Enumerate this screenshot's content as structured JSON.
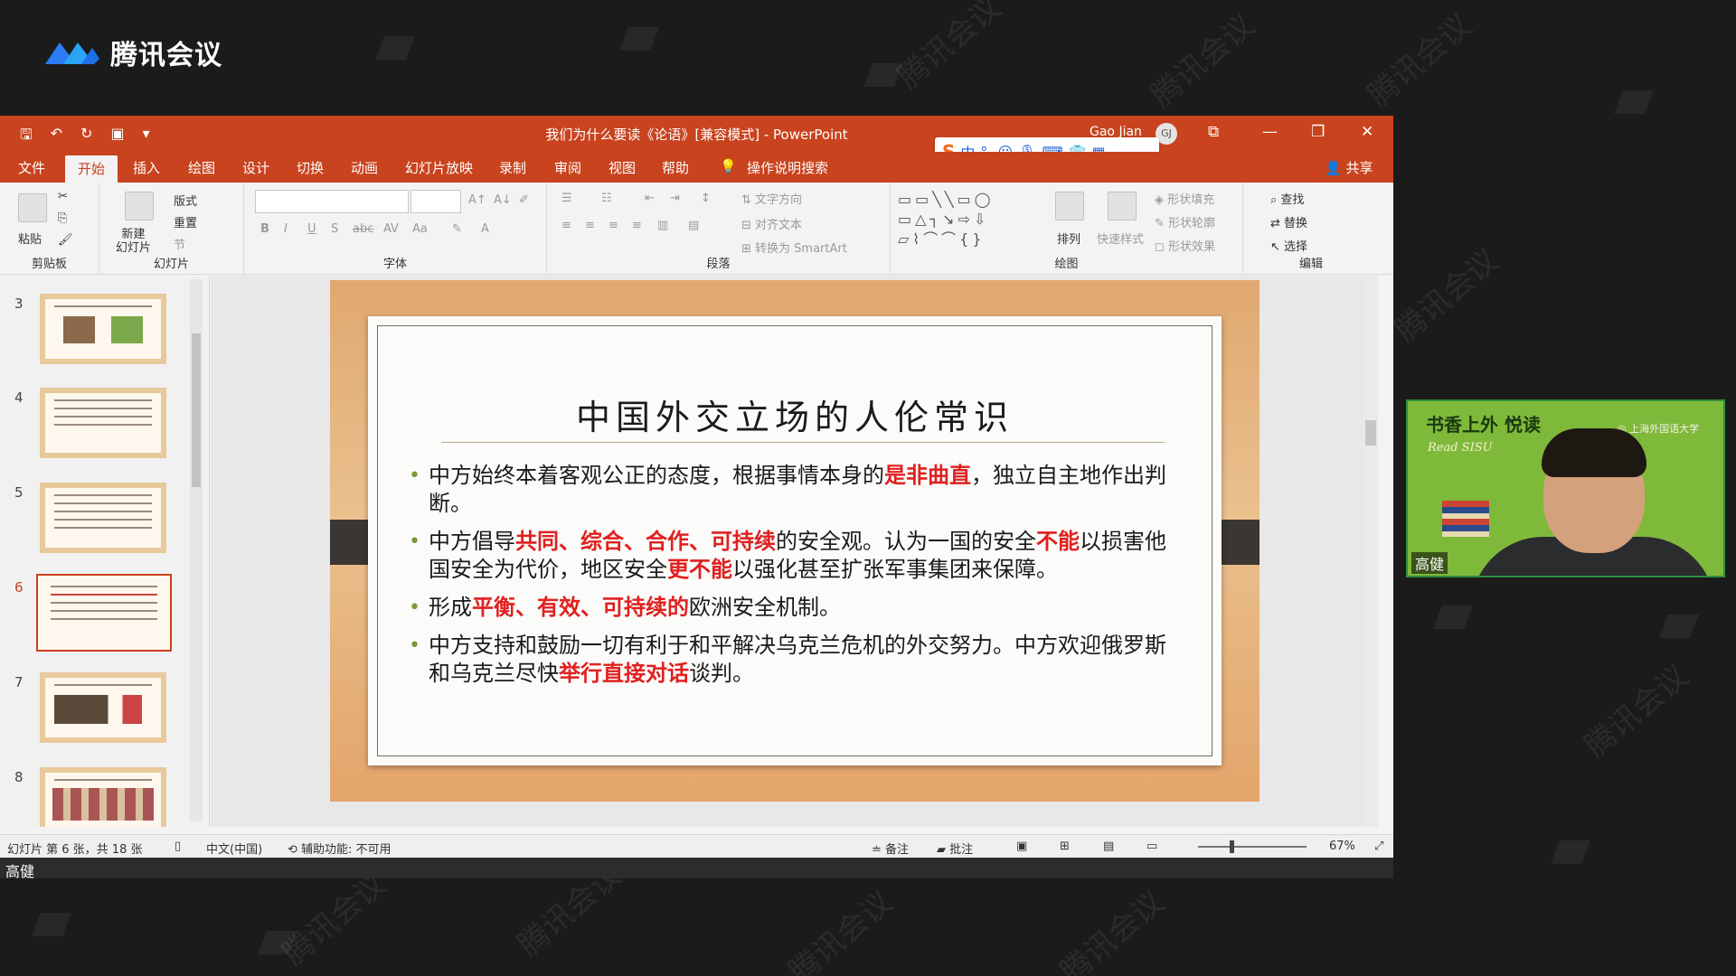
{
  "app": {
    "name": "腾讯会议",
    "watermark": "腾讯会议"
  },
  "ppt": {
    "titlebar": {
      "title": "我们为什么要读《论语》[兼容模式] - PowerPoint",
      "user": "Gao Jian",
      "avatar_initials": "GJ"
    },
    "ime": {
      "mode": "中"
    },
    "menu": {
      "tabs": [
        "文件",
        "开始",
        "插入",
        "绘图",
        "设计",
        "切换",
        "动画",
        "幻灯片放映",
        "录制",
        "审阅",
        "视图",
        "帮助",
        "操作说明搜索"
      ],
      "active_tab": "开始",
      "share": "共享"
    },
    "ribbon": {
      "clipboard": {
        "label": "剪贴板",
        "paste": "粘贴"
      },
      "slides": {
        "label": "幻灯片",
        "new_slide": "新建\n幻灯片",
        "layout": "版式",
        "reset": "重置",
        "section": "节"
      },
      "font": {
        "label": "字体"
      },
      "paragraph": {
        "label": "段落",
        "text_direction": "文字方向",
        "align_text": "对齐文本",
        "convert_smartart": "转换为 SmartArt"
      },
      "drawing": {
        "label": "绘图",
        "arrange": "排列",
        "quick_styles": "快速样式",
        "shape_fill": "形状填充",
        "shape_outline": "形状轮廓",
        "shape_effects": "形状效果"
      },
      "editing": {
        "label": "编辑",
        "find": "查找",
        "replace": "替换",
        "select": "选择"
      }
    },
    "thumbnails": [
      {
        "num": "3"
      },
      {
        "num": "4"
      },
      {
        "num": "5"
      },
      {
        "num": "6",
        "active": true
      },
      {
        "num": "7"
      },
      {
        "num": "8"
      }
    ],
    "slide": {
      "title": "中国外交立场的人伦常识",
      "bullets": [
        {
          "parts": [
            {
              "t": "中方始终本着客观公正的态度，根据事情本身的"
            },
            {
              "t": "是非曲直",
              "red": true
            },
            {
              "t": "，独立自主地作出判断。"
            }
          ]
        },
        {
          "parts": [
            {
              "t": "中方倡导"
            },
            {
              "t": "共同、综合、合作、可持续",
              "red": true
            },
            {
              "t": "的安全观。认为一国的安全"
            },
            {
              "t": "不能",
              "red": true
            },
            {
              "t": "以损害他国安全为代价，地区安全"
            },
            {
              "t": "更不能",
              "red": true
            },
            {
              "t": "以强化甚至扩张军事集团来保障。"
            }
          ]
        },
        {
          "parts": [
            {
              "t": "形成"
            },
            {
              "t": "平衡、有效、可持续的",
              "red": true
            },
            {
              "t": "欧洲安全机制。"
            }
          ]
        },
        {
          "parts": [
            {
              "t": "中方支持和鼓励一切有利于和平解决乌克兰危机的外交努力。中方欢迎俄罗斯和乌克兰尽快"
            },
            {
              "t": "举行直接对话",
              "red": true
            },
            {
              "t": "谈判。"
            }
          ]
        }
      ]
    },
    "statusbar": {
      "slide_info": "幻灯片 第 6 张，共 18 张",
      "language": "中文(中国)",
      "accessibility": "辅助功能: 不可用",
      "notes": "备注",
      "comments": "批注",
      "zoom": "67%"
    },
    "speaker_label": "高健"
  },
  "video": {
    "banner_cn": "书香上外 悦读",
    "banner_en": "Read SISU",
    "school": "上海外国语大学",
    "participant": "高健"
  },
  "colors": {
    "ppt_accent": "#c8431e",
    "highlight_red": "#e02020",
    "video_bg": "#7fb93a"
  }
}
